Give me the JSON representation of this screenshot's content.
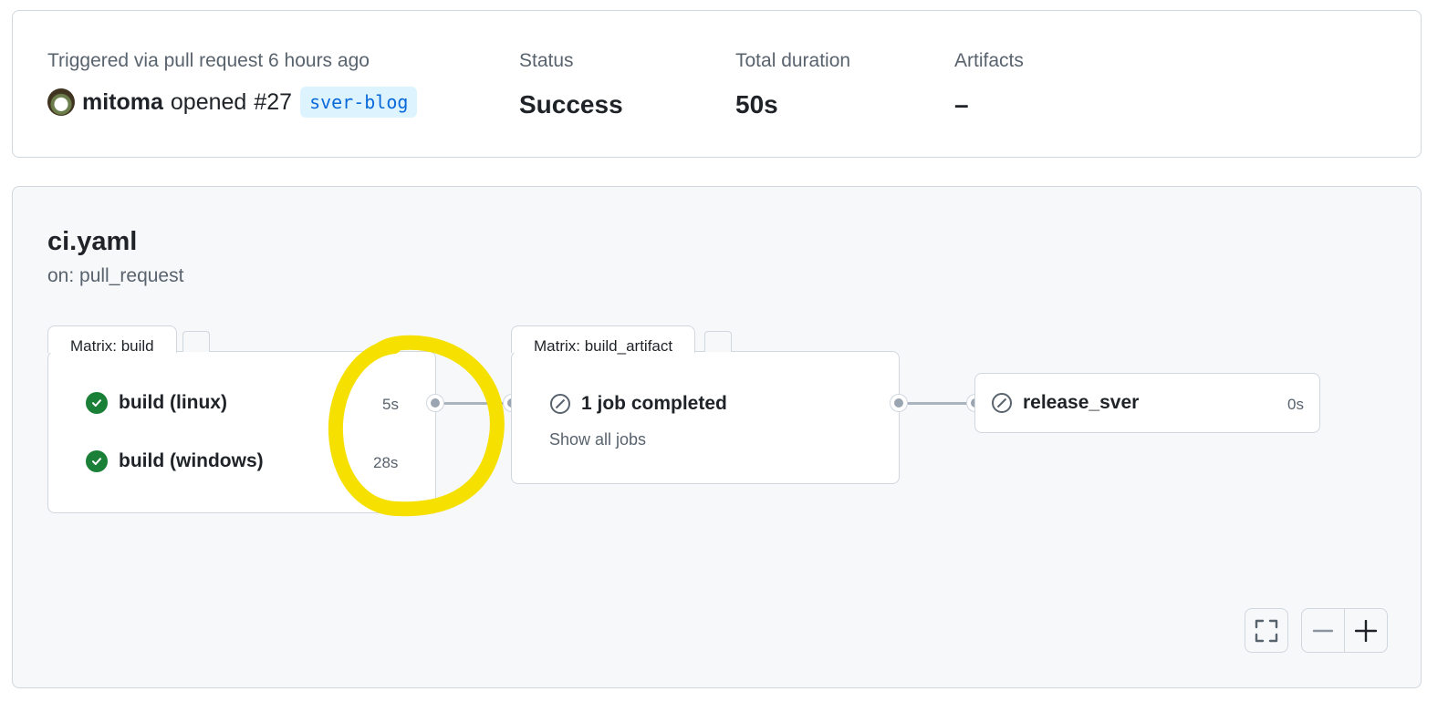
{
  "summary": {
    "trigger_label": "Triggered via pull request 6 hours ago",
    "actor": "mitoma",
    "action": "opened",
    "pr_number": "#27",
    "branch": "sver-blog",
    "status_label": "Status",
    "status_value": "Success",
    "duration_label": "Total duration",
    "duration_value": "50s",
    "artifacts_label": "Artifacts",
    "artifacts_value": "–"
  },
  "workflow": {
    "file": "ci.yaml",
    "trigger": "on: pull_request",
    "matrix_build": {
      "tab": "Matrix: build",
      "jobs": [
        {
          "name": "build (linux)",
          "duration": "5s",
          "status": "success"
        },
        {
          "name": "build (windows)",
          "duration": "28s",
          "status": "success"
        }
      ]
    },
    "matrix_artifact": {
      "tab": "Matrix: build_artifact",
      "summary": "1 job completed",
      "show_all": "Show all jobs"
    },
    "release": {
      "name": "release_sver",
      "duration": "0s",
      "status": "skipped"
    }
  },
  "colors": {
    "success": "#1a7f37",
    "annotation_highlight": "#f5e000",
    "branch_bg": "#ddf4ff",
    "branch_fg": "#0969da"
  },
  "icons": [
    "check-circle-icon",
    "skipped-icon",
    "fullscreen-icon",
    "zoom-out-icon",
    "zoom-in-icon"
  ]
}
